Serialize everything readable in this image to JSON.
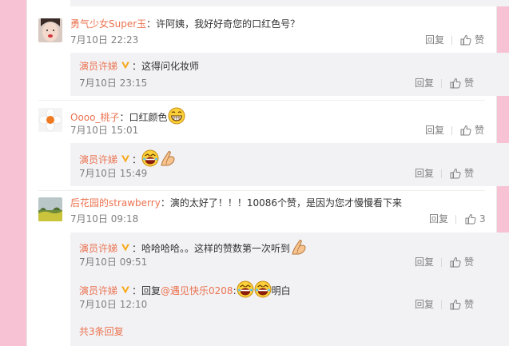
{
  "comments": [
    {
      "user": "勇气少女Super玉",
      "text": "：许阿姨，我好好奇您的口红色号？",
      "time": "7月10日 22:23",
      "reply_label": "回复",
      "like_label": "赞",
      "replies": [
        {
          "user": "演员许娣",
          "text": "：这得问化妆师",
          "time": "7月10日 23:15",
          "reply_label": "回复",
          "like_label": "赞"
        }
      ]
    },
    {
      "user": "Oooo_桃子",
      "text": "：口红颜色",
      "time": "7月10日 15:01",
      "reply_label": "回复",
      "like_label": "赞",
      "replies": [
        {
          "user": "演员许娣",
          "text": "：",
          "time": "7月10日 15:49",
          "reply_label": "回复",
          "like_label": "赞"
        }
      ]
    },
    {
      "user": "后花园的strawberry",
      "text": "：演的太好了！！！10086个赞，是因为您才慢慢看下来",
      "time": "7月10日 09:18",
      "reply_label": "回复",
      "like_label": "3",
      "replies": [
        {
          "user": "演员许娣",
          "text": "：哈哈哈哈。。这样的赞数第一次听到",
          "time": "7月10日 09:51",
          "reply_label": "回复",
          "like_label": "赞"
        },
        {
          "user": "演员许娣",
          "text_prefix": "：回复",
          "mention": "@遇见快乐0208",
          "text_suffix": ":",
          "text_end": "明白",
          "time": "7月10日 12:10",
          "reply_label": "回复",
          "like_label": "赞"
        }
      ],
      "more_label": "共3条回复"
    }
  ],
  "colors": {
    "accent": "#eb7350",
    "page_bg": "#f7c2d3",
    "sub_bg": "#f2f2f5",
    "muted": "#808080"
  }
}
